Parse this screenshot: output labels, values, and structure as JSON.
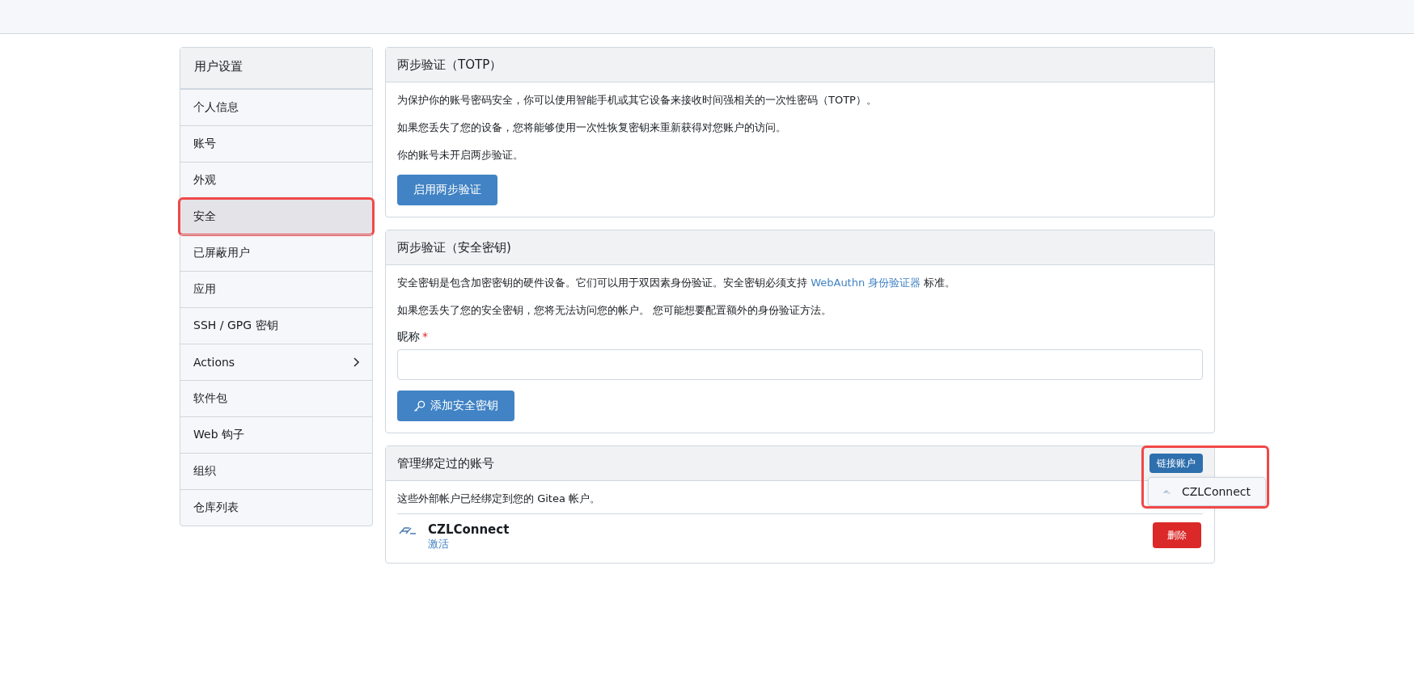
{
  "sidebar": {
    "title": "用户设置",
    "items": [
      {
        "label": "个人信息",
        "selected": false,
        "highlighted": false,
        "has_submenu": false
      },
      {
        "label": "账号",
        "selected": false,
        "highlighted": false,
        "has_submenu": false
      },
      {
        "label": "外观",
        "selected": false,
        "highlighted": false,
        "has_submenu": false
      },
      {
        "label": "安全",
        "selected": true,
        "highlighted": true,
        "has_submenu": false
      },
      {
        "label": "已屏蔽用户",
        "selected": false,
        "highlighted": false,
        "has_submenu": false
      },
      {
        "label": "应用",
        "selected": false,
        "highlighted": false,
        "has_submenu": false
      },
      {
        "label": "SSH / GPG 密钥",
        "selected": false,
        "highlighted": false,
        "has_submenu": false
      },
      {
        "label": "Actions",
        "selected": false,
        "highlighted": false,
        "has_submenu": true
      },
      {
        "label": "软件包",
        "selected": false,
        "highlighted": false,
        "has_submenu": false
      },
      {
        "label": "Web 钩子",
        "selected": false,
        "highlighted": false,
        "has_submenu": false
      },
      {
        "label": "组织",
        "selected": false,
        "highlighted": false,
        "has_submenu": false
      },
      {
        "label": "仓库列表",
        "selected": false,
        "highlighted": false,
        "has_submenu": false
      }
    ]
  },
  "totp": {
    "title": "两步验证（TOTP）",
    "paragraphs": [
      "为保护你的账号密码安全，你可以使用智能手机或其它设备来接收时间强相关的一次性密码（TOTP）。",
      "如果您丢失了您的设备，您将能够使用一次性恢复密钥来重新获得对您账户的访问。",
      "你的账号未开启两步验证。"
    ],
    "button": "启用两步验证"
  },
  "security_key": {
    "title": "两步验证（安全密钥)",
    "intro": "安全密钥是包含加密密钥的硬件设备。它们可以用于双因素身份验证。安全密钥必须支持",
    "link": "WebAuthn 身份验证器",
    "intro_end": "标准。",
    "warning": "如果您丢失了您的安全密钥，您将无法访问您的帐户。 您可能想要配置额外的身份验证方法。",
    "field_label": "昵称",
    "required_mark": "*",
    "button": "添加安全密钥"
  },
  "linked_accounts": {
    "title": "管理绑定过的账号",
    "link_button": "链接账户",
    "highlighted": true,
    "menu_open": true,
    "menu_items": [
      "CZLConnect"
    ],
    "description": "这些外部帐户已经绑定到您的 Gitea 帐户。",
    "accounts": [
      {
        "name": "CZLConnect",
        "status": "激活",
        "button": "删除"
      }
    ]
  }
}
